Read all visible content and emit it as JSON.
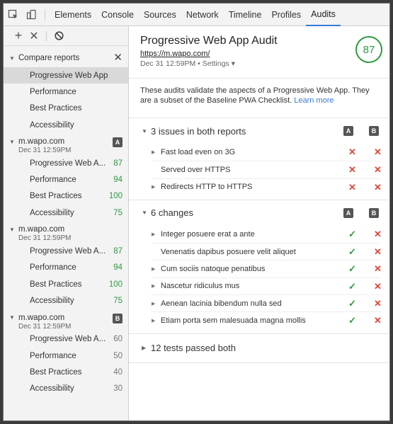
{
  "toolbar": {
    "tabs": [
      "Elements",
      "Console",
      "Sources",
      "Network",
      "Timeline",
      "Profiles",
      "Audits"
    ],
    "active_tab": "Audits"
  },
  "sidebar": {
    "compare_label": "Compare reports",
    "compare_items": [
      "Progressive Web App",
      "Performance",
      "Best Practices",
      "Accessibility"
    ],
    "reports": [
      {
        "name": "m.wapo.com",
        "date": "Dec 31 12:59PM",
        "badge": "A",
        "items": [
          {
            "label": "Progressive Web A...",
            "score": "87"
          },
          {
            "label": "Performance",
            "score": "94"
          },
          {
            "label": "Best Practices",
            "score": "100"
          },
          {
            "label": "Accessibility",
            "score": "75"
          }
        ]
      },
      {
        "name": "m.wapo.com",
        "date": "Dec 31 12:59PM",
        "badge": "",
        "items": [
          {
            "label": "Progressive Web A...",
            "score": "87"
          },
          {
            "label": "Performance",
            "score": "94"
          },
          {
            "label": "Best Practices",
            "score": "100"
          },
          {
            "label": "Accessibility",
            "score": "75"
          }
        ]
      },
      {
        "name": "m.wapo.com",
        "date": "Dec 31 12:59PM",
        "badge": "B",
        "items": [
          {
            "label": "Progressive Web A...",
            "score": "60"
          },
          {
            "label": "Performance",
            "score": "50"
          },
          {
            "label": "Best Practices",
            "score": "40"
          },
          {
            "label": "Accessibility",
            "score": "30"
          }
        ]
      }
    ]
  },
  "main": {
    "title": "Progressive Web App Audit",
    "url": "https://m.wapo.com/",
    "date": "Dec 31 12:59PM",
    "settings_label": "Settings ▾",
    "score": "87",
    "description": "These audits validate the aspects of a Progressive Web App. They are a subset of the Baseline PWA Checklist.",
    "learn_more": "Learn more",
    "sections": [
      {
        "title": "3 issues in both reports",
        "items": [
          {
            "label": "Fast load even on 3G",
            "expandable": true,
            "a": "fail",
            "b": "fail"
          },
          {
            "label": "Served over HTTPS",
            "expandable": false,
            "a": "fail",
            "b": "fail"
          },
          {
            "label": "Redirects HTTP to HTTPS",
            "expandable": true,
            "a": "fail",
            "b": "fail"
          }
        ]
      },
      {
        "title": "6 changes",
        "items": [
          {
            "label": "Integer posuere erat a ante",
            "expandable": true,
            "a": "pass",
            "b": "fail"
          },
          {
            "label": "Venenatis dapibus posuere velit aliquet",
            "expandable": false,
            "a": "pass",
            "b": "fail"
          },
          {
            "label": "Cum sociis natoque penatibus",
            "expandable": true,
            "a": "pass",
            "b": "fail"
          },
          {
            "label": "Nascetur ridiculus mus",
            "expandable": true,
            "a": "pass",
            "b": "fail"
          },
          {
            "label": "Aenean lacinia bibendum nulla sed",
            "expandable": true,
            "a": "pass",
            "b": "fail"
          },
          {
            "label": "Etiam porta sem malesuada magna mollis",
            "expandable": true,
            "a": "pass",
            "b": "fail"
          }
        ]
      }
    ],
    "passed_label": "12 tests passed both",
    "column_a": "A",
    "column_b": "B"
  },
  "colors": {
    "pass": "#2e9a3f",
    "fail": "#e0463b",
    "accent": "#3879d9"
  }
}
